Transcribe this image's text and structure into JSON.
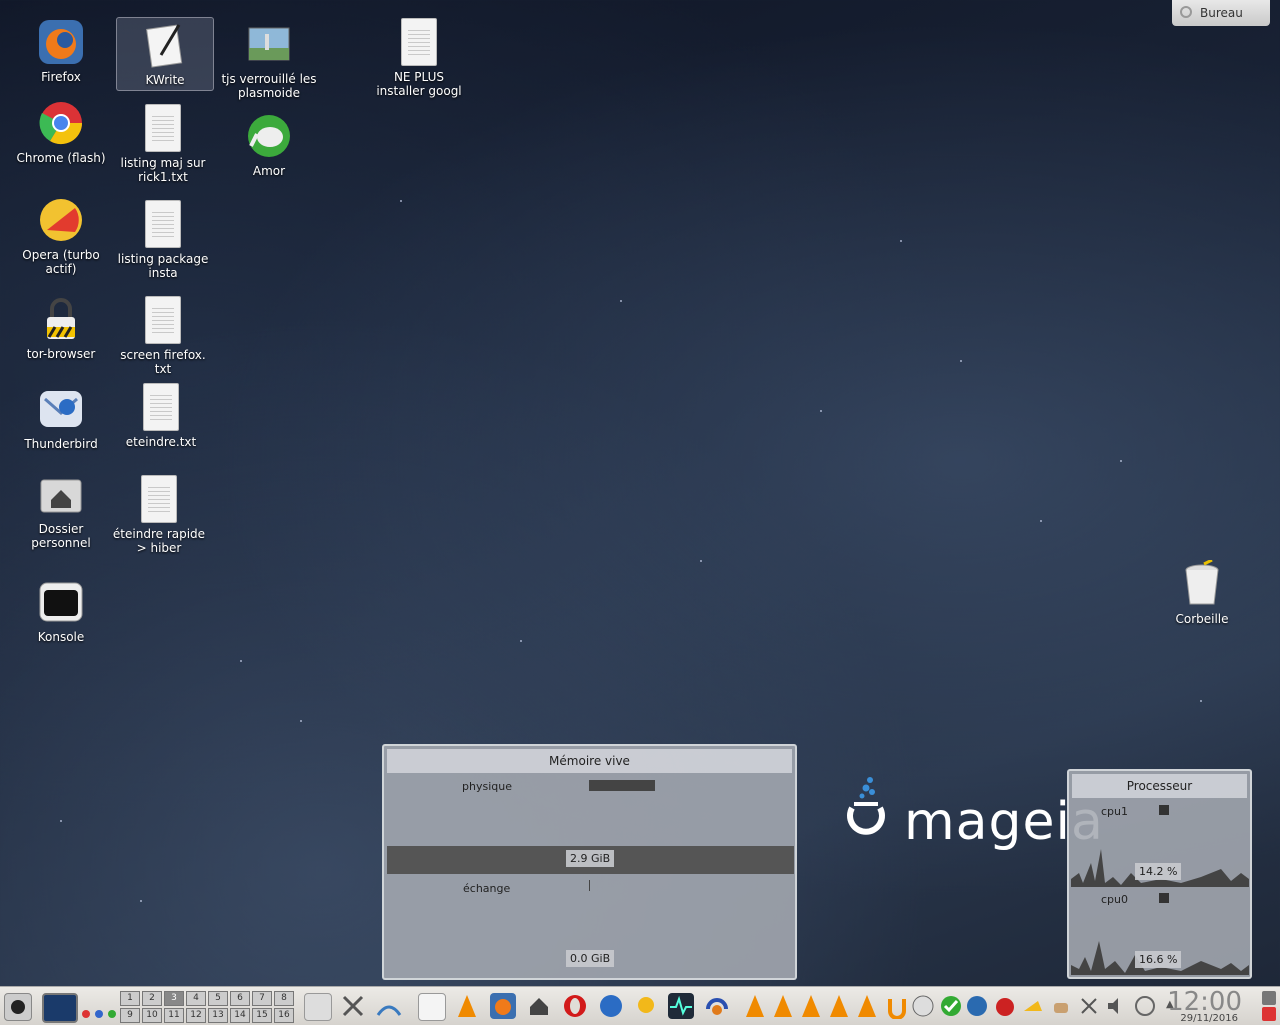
{
  "desktop": {
    "bureau_label": "Bureau",
    "icons": [
      {
        "label": "Firefox"
      },
      {
        "label": "Chrome (flash)"
      },
      {
        "label": "Opera (turbo actif)"
      },
      {
        "label": "tor-browser"
      },
      {
        "label": "Thunderbird"
      },
      {
        "label": "Dossier personnel"
      },
      {
        "label": "Konsole"
      },
      {
        "label": "KWrite"
      },
      {
        "label": "listing maj sur rick1.txt"
      },
      {
        "label": "listing package insta"
      },
      {
        "label": "screen firefox. txt"
      },
      {
        "label": "eteindre.txt"
      },
      {
        "label": "éteindre rapide > hiber"
      },
      {
        "label": "tjs verrouillé les plasmoide"
      },
      {
        "label": "Amor"
      },
      {
        "label": "NE PLUS installer googl"
      },
      {
        "label": "Corbeille"
      }
    ]
  },
  "memory_widget": {
    "title": "Mémoire vive",
    "physique_label": "physique",
    "physique_value": "2.9 GiB",
    "echange_label": "échange",
    "echange_value": "0.0 GiB"
  },
  "cpu_widget": {
    "title": "Processeur",
    "cpu1_label": "cpu1",
    "cpu1_value": "14.2 %",
    "cpu0_label": "cpu0",
    "cpu0_value": "16.6 %"
  },
  "logo_text": "mageia",
  "taskbar": {
    "pager": [
      "1",
      "2",
      "3",
      "4",
      "5",
      "6",
      "7",
      "8",
      "9",
      "10",
      "11",
      "12",
      "13",
      "14",
      "15",
      "16"
    ],
    "clock": "12:00",
    "date": "29/11/2016"
  },
  "colors": {
    "taskbar_bg": "#e0ddd8",
    "widget_bg": "#a5aab2",
    "logo_accent": "#3a8fd8"
  }
}
